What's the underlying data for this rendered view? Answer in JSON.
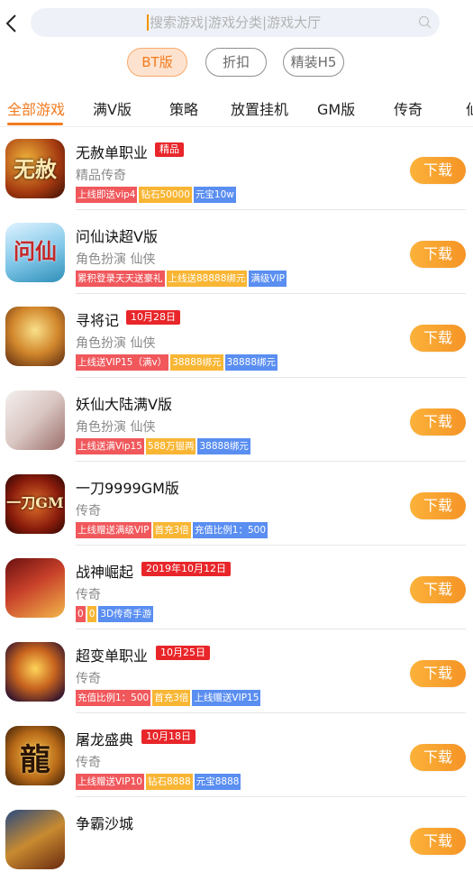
{
  "search": {
    "placeholder": "搜索游戏|游戏分类|游戏大厅"
  },
  "filters": [
    {
      "label": "BT版",
      "active": true
    },
    {
      "label": "折扣",
      "active": false
    },
    {
      "label": "精装H5",
      "active": false
    }
  ],
  "tabs": [
    {
      "label": "全部游戏",
      "active": true
    },
    {
      "label": "满V版",
      "active": false
    },
    {
      "label": "策略",
      "active": false
    },
    {
      "label": "放置挂机",
      "active": false
    },
    {
      "label": "GM版",
      "active": false
    },
    {
      "label": "传奇",
      "active": false
    },
    {
      "label": "仙",
      "active": false
    }
  ],
  "download_label": "下载",
  "games": [
    {
      "name": "无赦单职业",
      "badge": "精品",
      "category": "精品传奇",
      "icon_text": "无赦",
      "tags": [
        {
          "text": "上线即送vip4",
          "color": "red"
        },
        {
          "text": "钻石50000",
          "color": "yellow"
        },
        {
          "text": "元宝10w",
          "color": "blue"
        }
      ]
    },
    {
      "name": "问仙诀超V版",
      "badge": "",
      "category": "角色扮演 仙侠",
      "icon_text": "问仙",
      "tags": [
        {
          "text": "累积登录天天送豪礼",
          "color": "red"
        },
        {
          "text": "上线送88888绑元",
          "color": "yellow"
        },
        {
          "text": "满级VIP",
          "color": "blue"
        }
      ]
    },
    {
      "name": "寻将记",
      "badge": "10月28日",
      "category": "角色扮演 仙侠",
      "icon_text": "",
      "tags": [
        {
          "text": "上线送VIP15（满v）",
          "color": "red"
        },
        {
          "text": "38888绑元",
          "color": "yellow"
        },
        {
          "text": "38888绑元",
          "color": "blue"
        }
      ]
    },
    {
      "name": "妖仙大陆满V版",
      "badge": "",
      "category": "角色扮演 仙侠",
      "icon_text": "",
      "tags": [
        {
          "text": "上线送满Vip15",
          "color": "red"
        },
        {
          "text": "588万银两",
          "color": "yellow"
        },
        {
          "text": "38888绑元",
          "color": "blue"
        }
      ]
    },
    {
      "name": "一刀9999GM版",
      "badge": "",
      "category": "传奇",
      "icon_text": "一刀GM",
      "tags": [
        {
          "text": "上线赠送满级VIP",
          "color": "red"
        },
        {
          "text": "首充3倍",
          "color": "yellow"
        },
        {
          "text": "充值比例1：500",
          "color": "blue"
        }
      ]
    },
    {
      "name": "战神崛起",
      "badge": "2019年10月12日",
      "category": "传奇",
      "icon_text": "",
      "tags": [
        {
          "text": "0",
          "color": "red"
        },
        {
          "text": "0",
          "color": "yellow"
        },
        {
          "text": "3D传奇手游",
          "color": "blue"
        }
      ]
    },
    {
      "name": "超变单职业",
      "badge": "10月25日",
      "category": "传奇",
      "icon_text": "",
      "tags": [
        {
          "text": "充值比例1：500",
          "color": "red"
        },
        {
          "text": "首充3倍",
          "color": "yellow"
        },
        {
          "text": "上线赠送VIP15",
          "color": "blue"
        }
      ]
    },
    {
      "name": "屠龙盛典",
      "badge": "10月18日",
      "category": "传奇",
      "icon_text": "龍",
      "tags": [
        {
          "text": "上线赠送VIP10",
          "color": "red"
        },
        {
          "text": "钻石8888",
          "color": "yellow"
        },
        {
          "text": "元宝8888",
          "color": "blue"
        }
      ]
    },
    {
      "name": "争霸沙城",
      "badge": "",
      "category": "",
      "icon_text": "",
      "tags": []
    }
  ]
}
